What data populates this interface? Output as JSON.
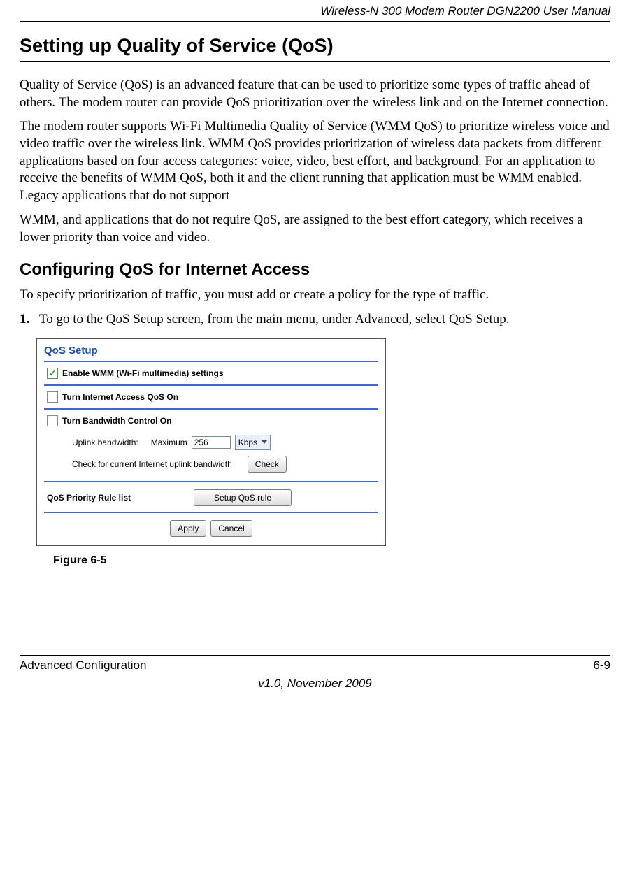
{
  "header": {
    "doc_title": "Wireless-N 300 Modem Router DGN2200 User Manual"
  },
  "h1": "Setting up Quality of Service (QoS)",
  "p1": "Quality of Service (QoS) is an advanced feature that can be used to prioritize some types of traffic ahead of others. The modem router can provide QoS prioritization over the wireless link and on the Internet connection.",
  "p2": "The modem router supports Wi-Fi Multimedia Quality of Service (WMM QoS) to prioritize wireless voice and video traffic over the wireless link. WMM QoS provides prioritization of wireless data packets from different applications based on four access categories: voice, video, best effort, and background. For an application to receive the benefits of WMM QoS, both it and the client running that application must be WMM enabled. Legacy applications that do not support",
  "p3": "WMM, and applications that do not require QoS, are assigned to the best effort category, which receives a lower priority than voice and video.",
  "h2": "Configuring QoS for Internet Access",
  "p4": "To specify prioritization of traffic, you must add or create a policy for the type of traffic.",
  "step1_num": "1.",
  "step1_text": "To go to the QoS Setup screen, from the main menu, under Advanced, select QoS Setup.",
  "screenshot": {
    "title": "QoS Setup",
    "wmm_label": "Enable WMM (Wi-Fi multimedia) settings",
    "internet_label": "Turn Internet Access QoS On",
    "bw_label": "Turn Bandwidth Control On",
    "uplink_label": "Uplink bandwidth:",
    "uplink_max": "Maximum",
    "uplink_value": "256",
    "uplink_unit": "Kbps",
    "check_label": "Check for current Internet uplink bandwidth",
    "check_btn": "Check",
    "prio_label": "QoS Priority Rule list",
    "setup_btn": "Setup QoS rule",
    "apply_btn": "Apply",
    "cancel_btn": "Cancel"
  },
  "figure_caption": "Figure 6-5",
  "footer": {
    "left": "Advanced Configuration",
    "right": "6-9",
    "version": "v1.0, November 2009"
  }
}
